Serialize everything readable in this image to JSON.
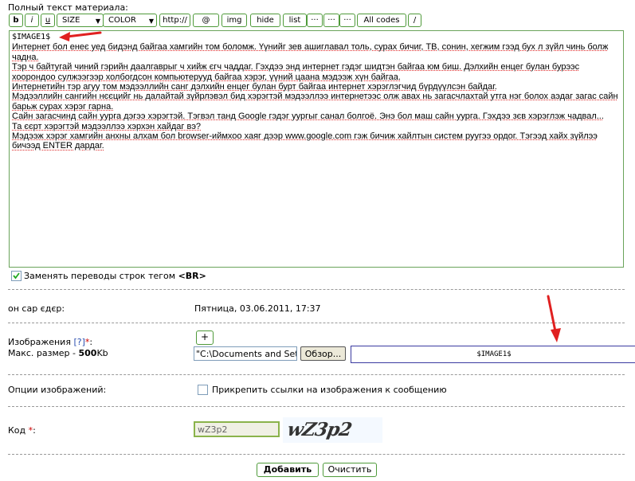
{
  "page_title": "Полный текст материала:",
  "toolbar": {
    "bold": "b",
    "italic": "i",
    "underline": "u",
    "size": "SIZE",
    "color": "COLOR",
    "http": "http://",
    "at": "@",
    "img": "img",
    "hide": "hide",
    "list": "list",
    "dots1": "···",
    "dots2": "···",
    "dots3": "···",
    "all_codes": "All codes",
    "slash": "/"
  },
  "editor": {
    "lines": [
      "$IMAGE1$",
      "Интернет бол енеє уед бидэнд байгаа хамгийн том боломж. Үүнийг зев ашиглавал толь, сурах бичиг, ТВ, сонин, хегжим гээд бух л зүйл чинь болж",
      "чадна.",
      "Тэр ч байтугай чиний гэрийн даалгаврыг ч хийж єгч чаддаг. Гэхдээ энд интернет гэдэг шидтэн байгаа юм биш. Дэлхийн енцег булан бурээс",
      "хоорондоо сулжээгээр холбогдсон компьютерууд байгаа хэрэг, үүний цаана мэдээж хүн байгаа.",
      "Интернетийн тэр агуу том мэдээллийн санг дэлхийн енцег булан бурт байгаа интернет хэрэглэгчид бүрдүүлсэн байдаг.",
      "Мэдээллийн сангийн нєєцийг нь далайтай зүйрлэвэл бид хэрэгтэй мэдээллээ интернетээс олж авах нь загасчлахтай утга нэг болох аэдаг загас сайн",
      "барьж сурах хэрэг гарна.",
      "Сайн загасчинд сайн уурга дэгээ хэрэгтэй. Тэгвэл танд Google гэдэг уургыг санал болгоё. Энэ бол маш сайн уурга. Гэхдээ зєв хэрэглэж чадвал...",
      "Та єєрт хэрэгтэй мэдээллээ хэрхэн хайдаг вэ?",
      "Мэдээж хэрэг хамгийн анхны алхам бол browser-иймхоо хаяг дээр www.google.com гэж бичиж хайлтын систем руугээ ордог. Тэгээд хайх зүйлээ",
      "бичээд ENTER дардаг."
    ]
  },
  "replace_br": {
    "label": "Заменять переводы строк тегом ",
    "tag": "<BR>",
    "checked": true
  },
  "date_row": {
    "label": "он сар єдєр:",
    "value": "Пятница, 03.06.2011, 17:37"
  },
  "images": {
    "label": "Изображения",
    "help": "[?]",
    "required": "*",
    "colon": ":",
    "max_label": "Макс. размер - ",
    "max_value": "500",
    "max_unit": "Kb",
    "add_label": "+",
    "file_value": "\"C:\\Documents and Settin",
    "browse_label": "Обзор...",
    "tag_value": "$IMAGE1$"
  },
  "image_options": {
    "label": "Опции изображений:",
    "checkbox_label": "Прикрепить ссылки на изображения к сообщению",
    "checked": false
  },
  "captcha": {
    "label": "Код",
    "required": "*",
    "colon": ":",
    "input_value": "wZ3p2",
    "image_text": "wZ3p2"
  },
  "buttons": {
    "submit": "Добавить",
    "reset": "Очистить"
  },
  "colors": {
    "border_green": "#4f9a3a",
    "arrow_red": "#e02020",
    "required_red": "#cc0000"
  }
}
